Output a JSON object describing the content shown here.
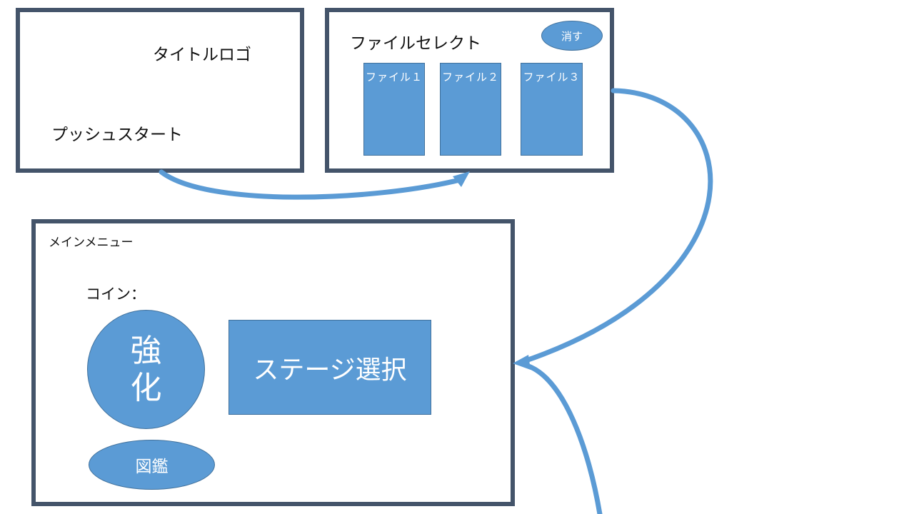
{
  "title_screen": {
    "logo_text": "タイトルロゴ",
    "push_start_text": "プッシュスタート"
  },
  "file_select": {
    "title": "ファイルセレクト",
    "delete_label": "消す",
    "files": [
      "ファイル１",
      "ファイル２",
      "ファイル３"
    ]
  },
  "main_menu": {
    "title": "メインメニュー",
    "coin_label": "コイン：",
    "upgrade_line1": "強",
    "upgrade_line2": "化",
    "stage_select_label": "ステージ選択",
    "encyclopedia_label": "図鑑"
  },
  "colors": {
    "frame": "#44546a",
    "accent": "#5b9bd5",
    "accent_border": "#41719c"
  }
}
